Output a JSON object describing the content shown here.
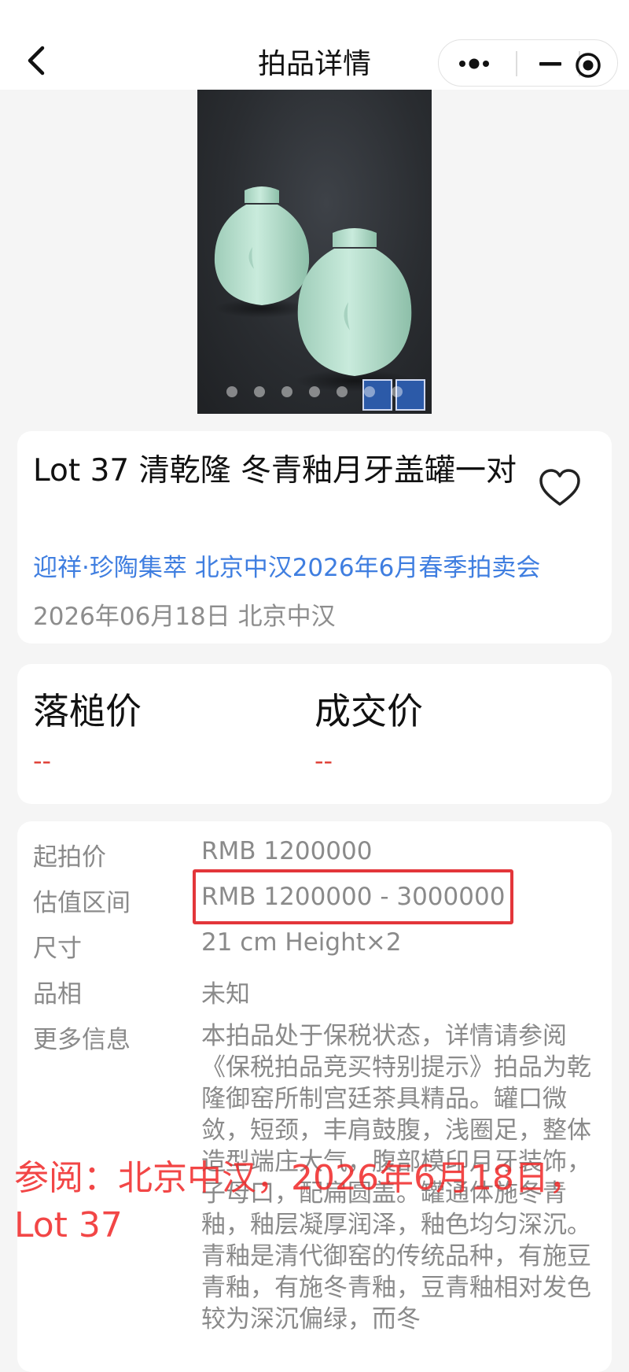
{
  "nav": {
    "title": "拍品详情"
  },
  "hero": {
    "dot_count": 9
  },
  "lot": {
    "title": "Lot 37 清乾隆 冬青釉月牙盖罐一对",
    "sale_name": "迎祥·珍陶集萃 北京中汉2026年6月春季拍卖会",
    "date_house": "2026年06月18日 北京中汉"
  },
  "prices": {
    "hammer_label": "落槌价",
    "hammer_value": "--",
    "deal_label": "成交价",
    "deal_value": "--"
  },
  "details": {
    "start_label": "起拍价",
    "start_value": "RMB 1200000",
    "estimate_label": "估值区间",
    "estimate_value": "RMB 1200000 - 3000000",
    "size_label": "尺寸",
    "size_value": "21 cm Height×2",
    "condition_label": "品相",
    "condition_value": "未知",
    "more_label": "更多信息",
    "more_value": "本拍品处于保税状态，详情请参阅《保税拍品竞买特别提示》拍品为乾隆御窑所制宫廷茶具精品。罐口微敛，短颈，丰肩鼓腹，浅圈足，整体造型端庄大气，腹部模印月牙装饰，子母口，配扁圆盖。罐通体施冬青釉，釉层凝厚润泽，釉色均匀深沉。青釉是清代御窑的传统品种，有施豆青釉，有施冬青釉，豆青釉相对发色较为深沉偏绿，而冬"
  },
  "watermark": {
    "text": "参阅：北京中汉，2026年6月18日，Lot 37"
  },
  "colors": {
    "link": "#3f7ee0",
    "price": "#e0443b",
    "highlight": "#e3363a",
    "watermark": "#f02828"
  }
}
